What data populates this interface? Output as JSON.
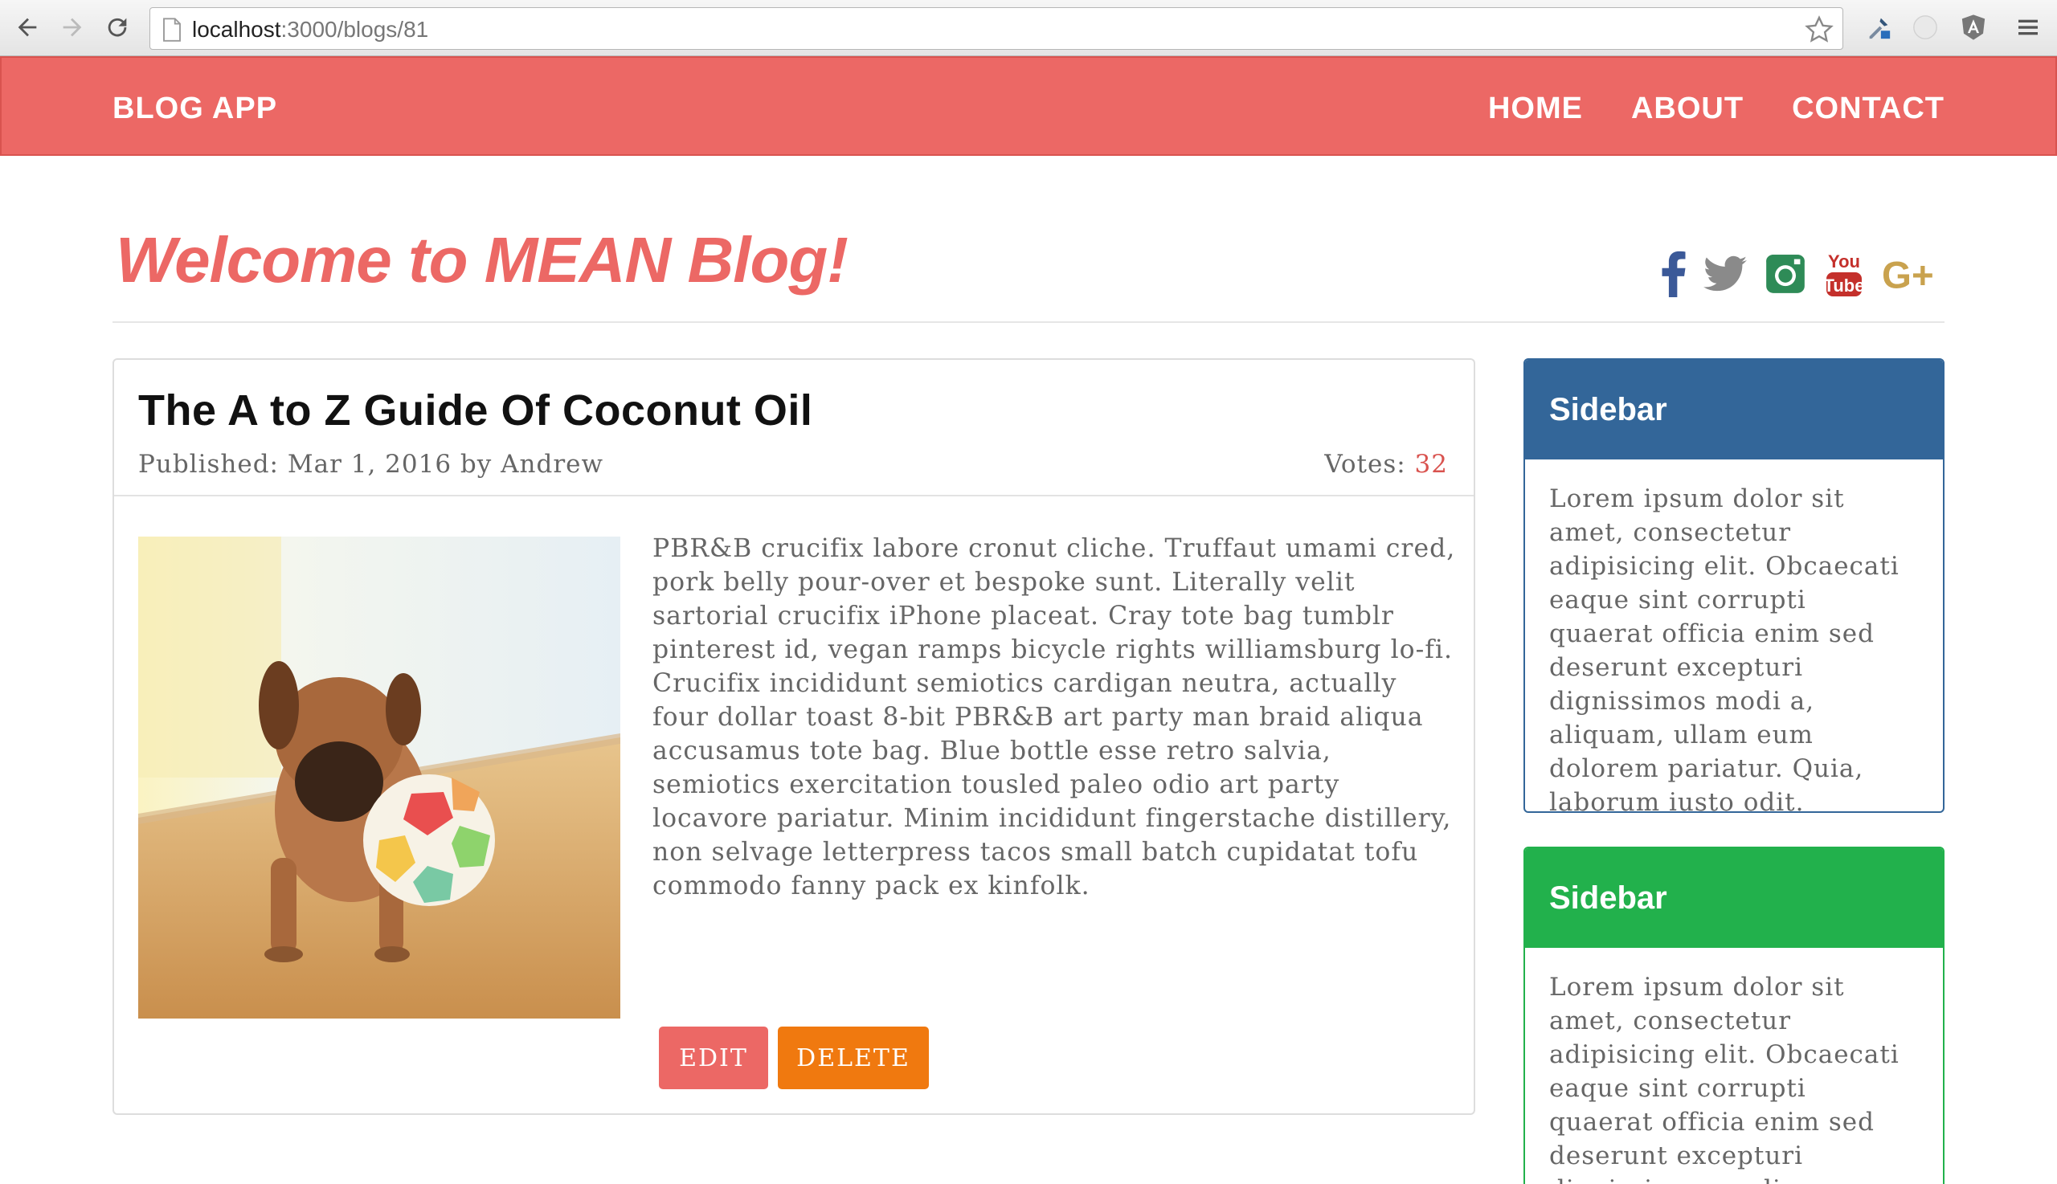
{
  "browser": {
    "url_host": "localhost",
    "url_path": ":3000/blogs/81"
  },
  "navbar": {
    "brand": "BLOG APP",
    "links": [
      {
        "label": "HOME"
      },
      {
        "label": "ABOUT"
      },
      {
        "label": "CONTACT"
      }
    ]
  },
  "header": {
    "title": "Welcome to MEAN Blog!",
    "social_icons": [
      "facebook-icon",
      "twitter-icon",
      "instagram-icon",
      "youtube-icon",
      "google-plus-icon"
    ],
    "youtube_text_top": "You",
    "youtube_text_bottom": "Tube",
    "google_plus_text": "G+"
  },
  "post": {
    "title": "The A to Z Guide Of Coconut Oil",
    "meta": "Published: Mar 1, 2016 by Andrew",
    "votes_label": "Votes:",
    "votes_count": "32",
    "body": "PBR&B crucifix labore cronut cliche. Truffaut umami cred, pork belly pour-over et bespoke sunt. Literally velit sartorial crucifix iPhone placeat. Cray tote bag tumblr pinterest id, vegan ramps bicycle rights williamsburg lo-fi. Crucifix incididunt semiotics cardigan neutra, actually four dollar toast 8-bit PBR&B art party man braid aliqua accusamus tote bag. Blue bottle esse retro salvia, semiotics exercitation tousled paleo odio art party locavore pariatur. Minim incididunt fingerstache distillery, non selvage letterpress tacos small batch cupidatat tofu commodo fanny pack ex kinfolk.",
    "edit_label": "EDIT",
    "delete_label": "DELETE"
  },
  "sidebars": [
    {
      "title": "Sidebar",
      "text": "Lorem ipsum dolor sit amet, consectetur adipisicing elit. Obcaecati eaque sint corrupti quaerat officia enim sed deserunt excepturi dignissimos modi a, aliquam, ullam eum dolorem pariatur. Quia, laborum iusto odit."
    },
    {
      "title": "Sidebar",
      "text": "Lorem ipsum dolor sit amet, consectetur adipisicing elit. Obcaecati eaque sint corrupti quaerat officia enim sed deserunt excepturi dignissimos modi a,"
    }
  ],
  "colors": {
    "primary": "#ec6865",
    "sidebar_blue": "#336699",
    "sidebar_green": "#22b14c",
    "delete_orange": "#f0790f",
    "facebook": "#3b5998",
    "twitter": "#8a8a8a",
    "instagram": "#2e8b57",
    "youtube": "#c4302b",
    "google_plus": "#c9a24e"
  }
}
